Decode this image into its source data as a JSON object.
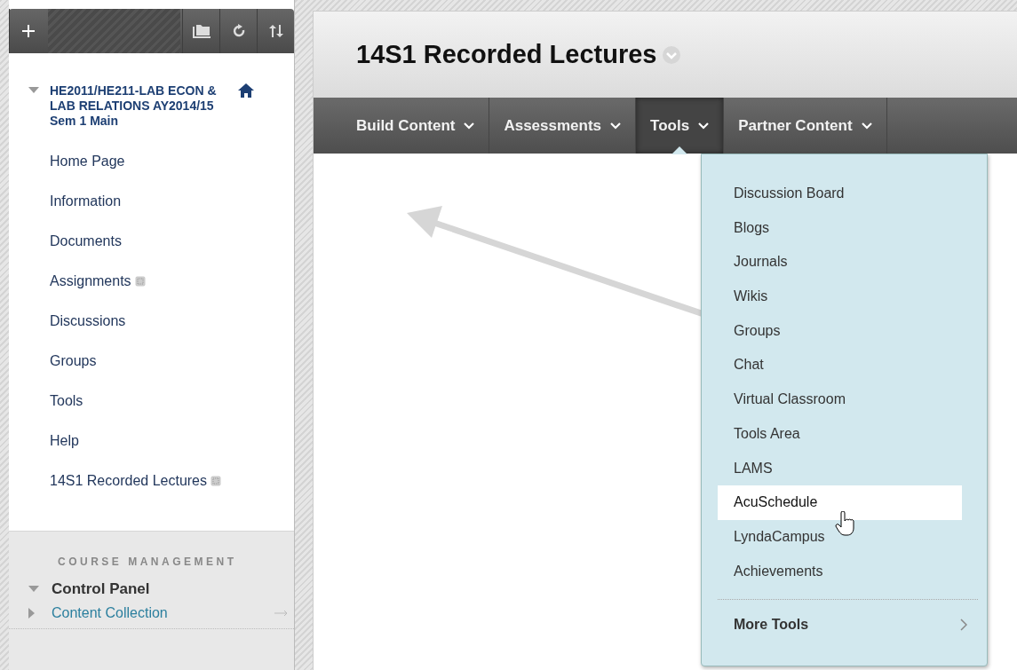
{
  "sidebar": {
    "course_title": "HE2011/HE211-LAB ECON & LAB RELATIONS AY2014/15 Sem 1 Main",
    "expanded": true,
    "items": [
      {
        "label": "Home Page",
        "hidden_badge": false
      },
      {
        "label": "Information",
        "hidden_badge": false
      },
      {
        "label": "Documents",
        "hidden_badge": false
      },
      {
        "label": "Assignments",
        "hidden_badge": true
      },
      {
        "label": "Discussions",
        "hidden_badge": false
      },
      {
        "label": "Groups",
        "hidden_badge": false
      },
      {
        "label": "Tools",
        "hidden_badge": false
      },
      {
        "label": "Help",
        "hidden_badge": false
      },
      {
        "label": "14S1 Recorded Lectures",
        "hidden_badge": true
      }
    ],
    "management": {
      "heading": "COURSE MANAGEMENT",
      "panel": {
        "label": "Control Panel",
        "expanded": true
      },
      "items": [
        {
          "label": "Content Collection",
          "expanded": false
        }
      ]
    }
  },
  "page_title": "14S1 Recorded Lectures",
  "menu_tabs": [
    {
      "label": "Build Content",
      "selected": false
    },
    {
      "label": "Assessments",
      "selected": false
    },
    {
      "label": "Tools",
      "selected": true
    },
    {
      "label": "Partner Content",
      "selected": false
    }
  ],
  "dropdown": {
    "items": [
      {
        "label": "Discussion Board",
        "selected": false
      },
      {
        "label": "Blogs",
        "selected": false
      },
      {
        "label": "Journals",
        "selected": false
      },
      {
        "label": "Wikis",
        "selected": false
      },
      {
        "label": "Groups",
        "selected": false
      },
      {
        "label": "Chat",
        "selected": false
      },
      {
        "label": "Virtual Classroom",
        "selected": false
      },
      {
        "label": "Tools Area",
        "selected": false
      },
      {
        "label": "LAMS",
        "selected": false
      },
      {
        "label": "AcuSchedule",
        "selected": true
      },
      {
        "label": "LyndaCampus",
        "selected": false
      },
      {
        "label": "Achievements",
        "selected": false
      }
    ],
    "more": "More Tools"
  }
}
